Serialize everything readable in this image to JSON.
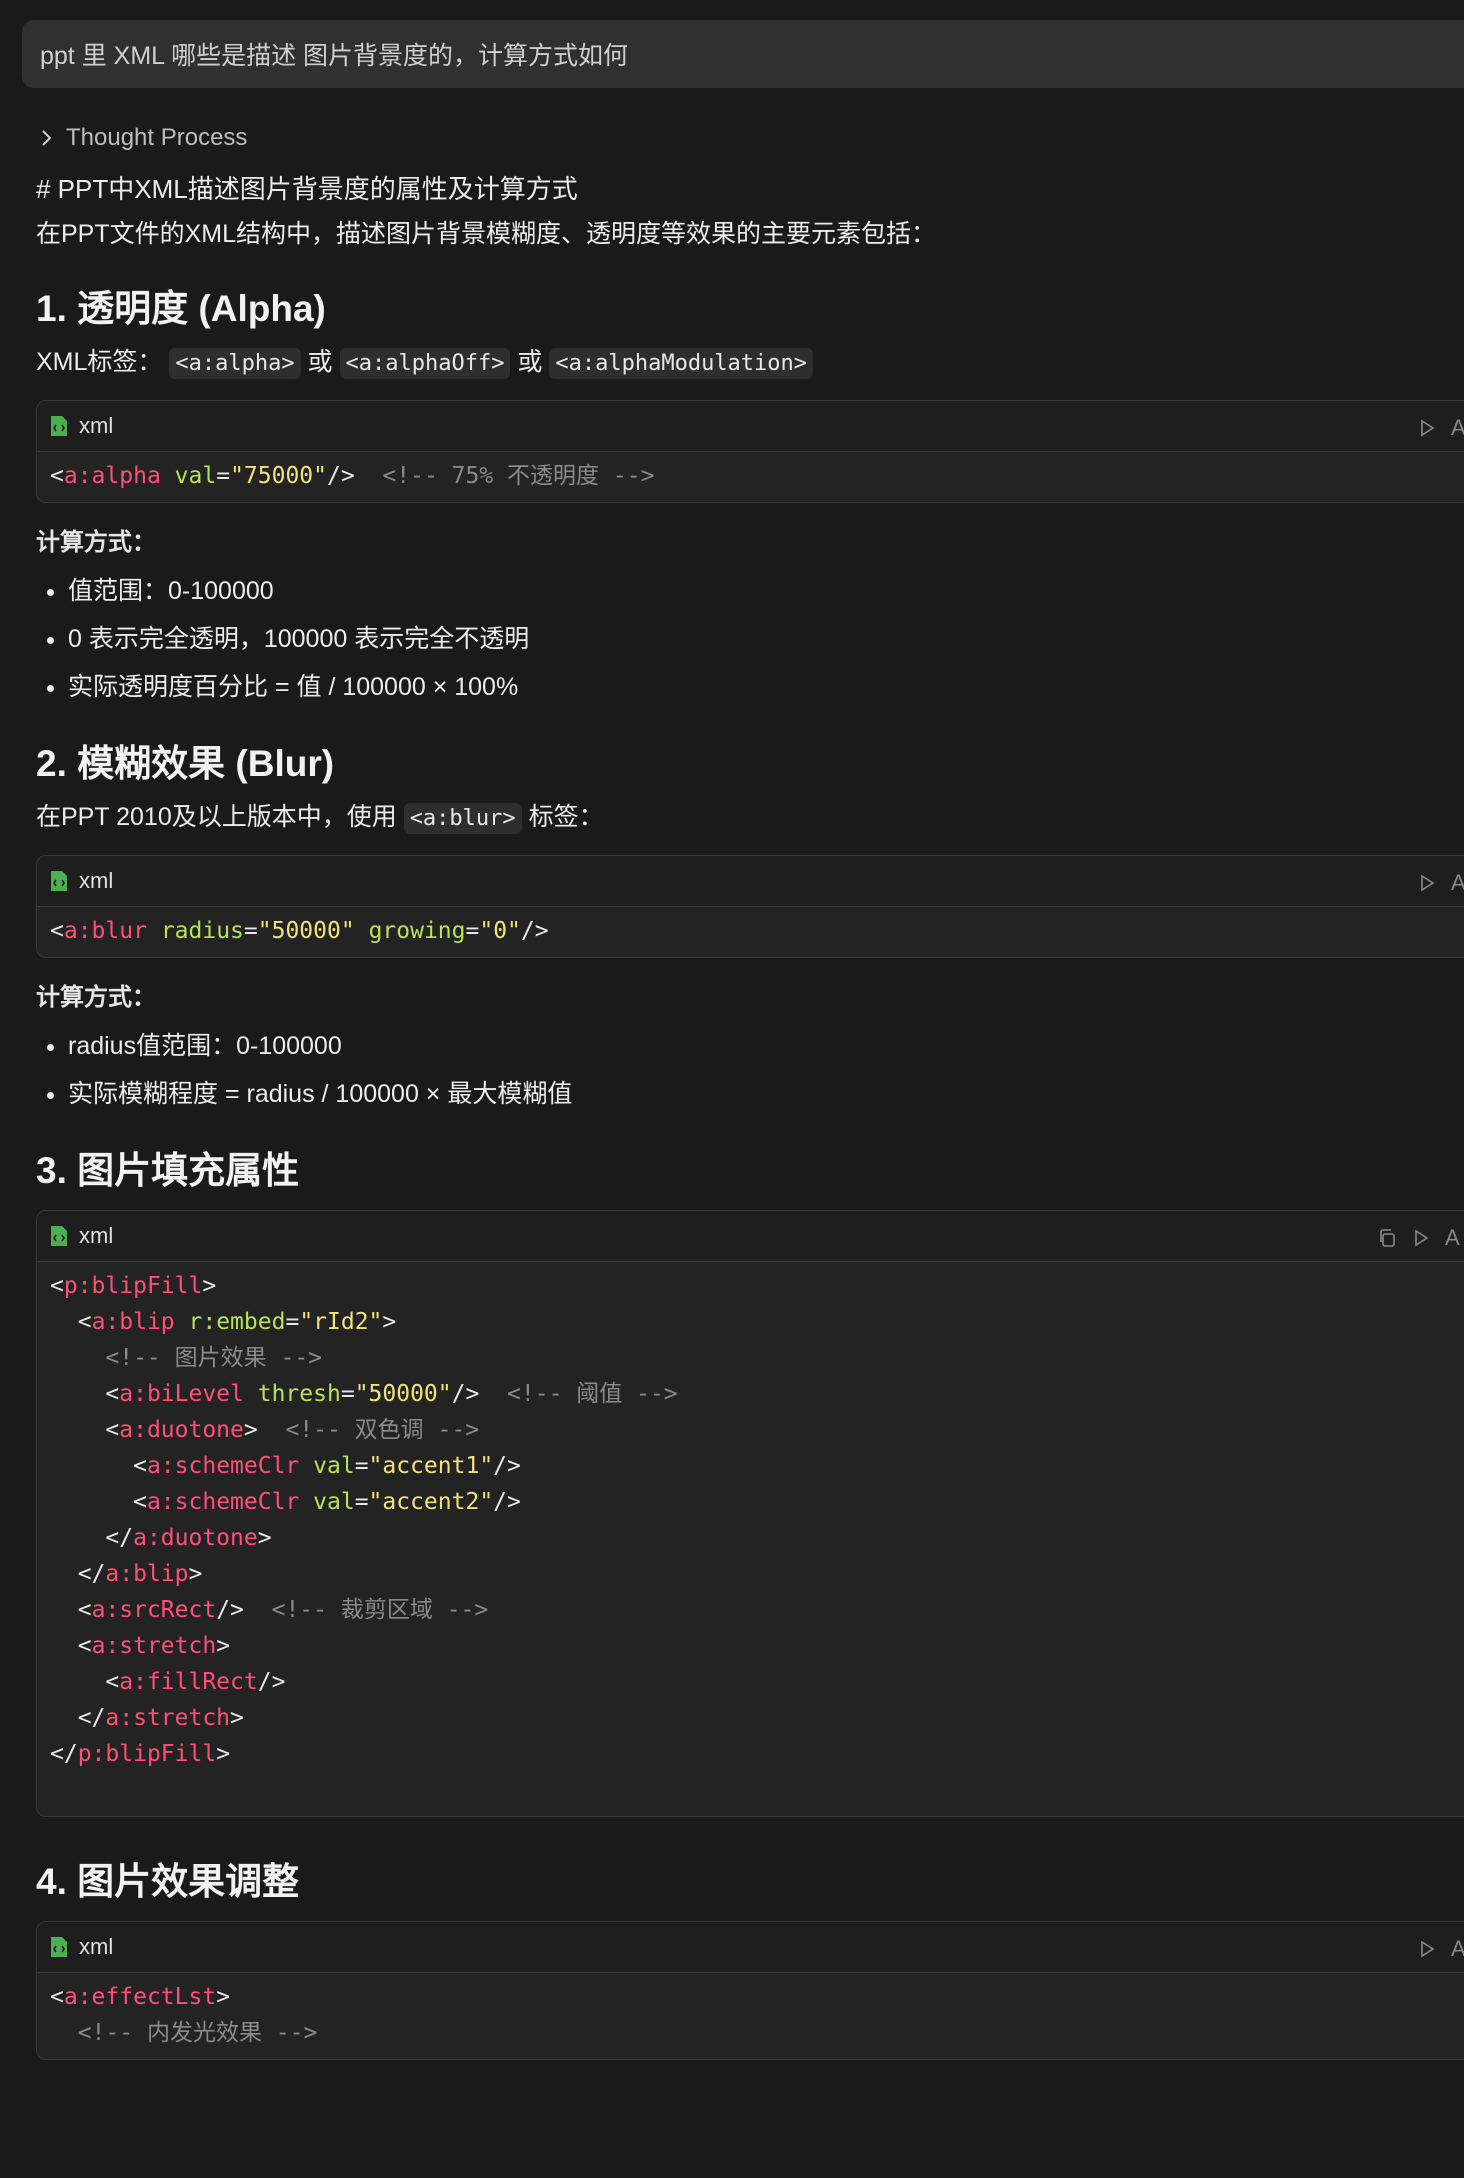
{
  "query": "ppt 里 XML 哪些是描述 图片背景度的，计算方式如何",
  "thought_label": "Thought Process",
  "heading_md": "# PPT中XML描述图片背景度的属性及计算方式",
  "intro": "在PPT文件的XML结构中，描述图片背景模糊度、透明度等效果的主要元素包括：",
  "code_lang": "xml",
  "sections": {
    "s1": {
      "title": "1. 透明度 (Alpha)",
      "tags_prefix": "XML标签：",
      "tag1": "<a:alpha>",
      "or": "或",
      "tag2": "<a:alphaOff>",
      "tag3": "<a:alphaModulation>",
      "code": {
        "t": "a:alpha",
        "a": "val",
        "v": "\"75000\"",
        "c": "<!-- 75% 不透明度 -->"
      },
      "calc_title": "计算方式：",
      "bullets": [
        "值范围：0-100000",
        "0 表示完全透明，100000 表示完全不透明",
        "实际透明度百分比 = 值 / 100000 × 100%"
      ]
    },
    "s2": {
      "title": "2. 模糊效果 (Blur)",
      "intro_pre": "在PPT 2010及以上版本中，使用",
      "tag": "<a:blur>",
      "intro_post": "标签：",
      "code": {
        "t": "a:blur",
        "a1": "radius",
        "v1": "\"50000\"",
        "a2": "growing",
        "v2": "\"0\""
      },
      "calc_title": "计算方式：",
      "bullets": [
        "radius值范围：0-100000",
        "实际模糊程度 = radius / 100000 × 最大模糊值"
      ]
    },
    "s3": {
      "title": "3. 图片填充属性",
      "code": {
        "blipFill": "p:blipFill",
        "blip": "a:blip",
        "embed_attr": "r:embed",
        "embed_val": "\"rId2\"",
        "cm_effects": "<!-- 图片效果 -->",
        "biLevel": "a:biLevel",
        "thresh_attr": "thresh",
        "thresh_val": "\"50000\"",
        "cm_thresh": "<!-- 阈值 -->",
        "duotone": "a:duotone",
        "cm_duotone": "<!-- 双色调 -->",
        "schemeClr": "a:schemeClr",
        "val_attr": "val",
        "accent1": "\"accent1\"",
        "accent2": "\"accent2\"",
        "srcRect": "a:srcRect",
        "cm_crop": "<!-- 裁剪区域 -->",
        "stretch": "a:stretch",
        "fillRect": "a:fillRect"
      }
    },
    "s4": {
      "title": "4. 图片效果调整",
      "code": {
        "effectLst": "a:effectLst",
        "cm_glow": "<!-- 内发光效果 -->"
      }
    }
  },
  "tools_cut_text": "A"
}
